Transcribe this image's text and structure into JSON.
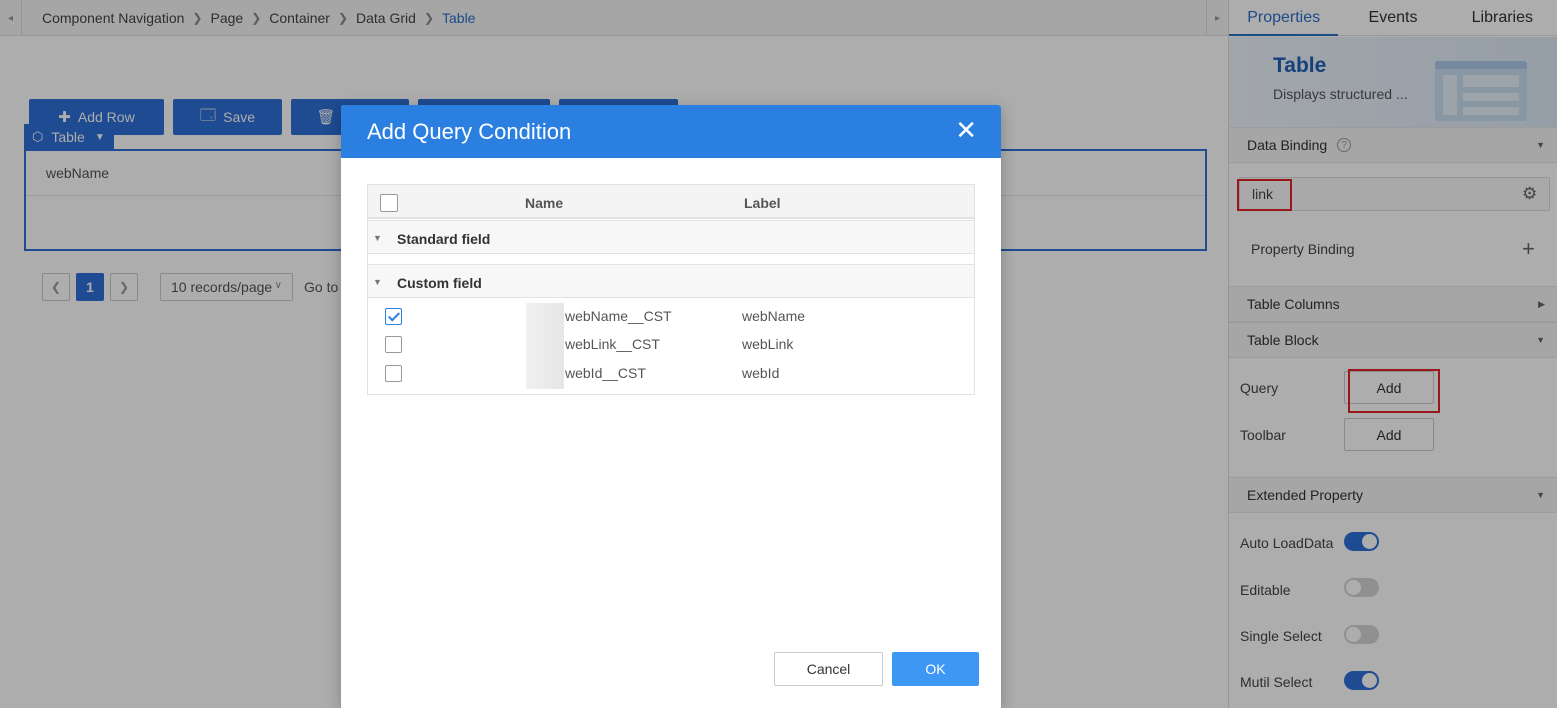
{
  "canvas": {
    "breadcrumb": [
      {
        "label": "Component Navigation"
      },
      {
        "label": "Page"
      },
      {
        "label": "Container"
      },
      {
        "label": "Data Grid"
      },
      {
        "label": "Table",
        "active": true
      }
    ],
    "toolbar": {
      "add_row": "Add Row",
      "save": "Save"
    },
    "table_tag": "Table",
    "table_columns": [
      "webName"
    ],
    "pagination": {
      "current_page": "1",
      "page_size": "10 records/page",
      "goto_label": "Go to"
    }
  },
  "right_panel": {
    "tabs": [
      {
        "label": "Properties",
        "active": true
      },
      {
        "label": "Events"
      },
      {
        "label": "Libraries"
      }
    ],
    "banner": {
      "title": "Table",
      "description": "Displays structured ..."
    },
    "sections": {
      "data_binding": "Data Binding",
      "table_columns": "Table Columns",
      "table_block": "Table Block",
      "extended_property": "Extended Property"
    },
    "data_binding_value": "link",
    "property_binding_label": "Property Binding",
    "table_block": {
      "query_label": "Query",
      "query_button": "Add",
      "toolbar_label": "Toolbar",
      "toolbar_button": "Add"
    },
    "extended": [
      {
        "label": "Auto LoadData",
        "on": true
      },
      {
        "label": "Editable",
        "on": false
      },
      {
        "label": "Single Select",
        "on": false
      },
      {
        "label": "Mutil Select",
        "on": true
      }
    ]
  },
  "dialog": {
    "title": "Add Query Condition",
    "columns": {
      "name": "Name",
      "label": "Label"
    },
    "groups": {
      "standard": "Standard field",
      "custom": "Custom field"
    },
    "fields": [
      {
        "name": "webName__CST",
        "label": "webName",
        "checked": true
      },
      {
        "name": "webLink__CST",
        "label": "webLink",
        "checked": false
      },
      {
        "name": "webId__CST",
        "label": "webId",
        "checked": false
      }
    ],
    "cancel": "Cancel",
    "ok": "OK"
  },
  "colors": {
    "primary": "#2d6fd6",
    "dialog_header": "#2a7fe0",
    "ok_button": "#3d98f5",
    "highlight": "#e0252b"
  }
}
